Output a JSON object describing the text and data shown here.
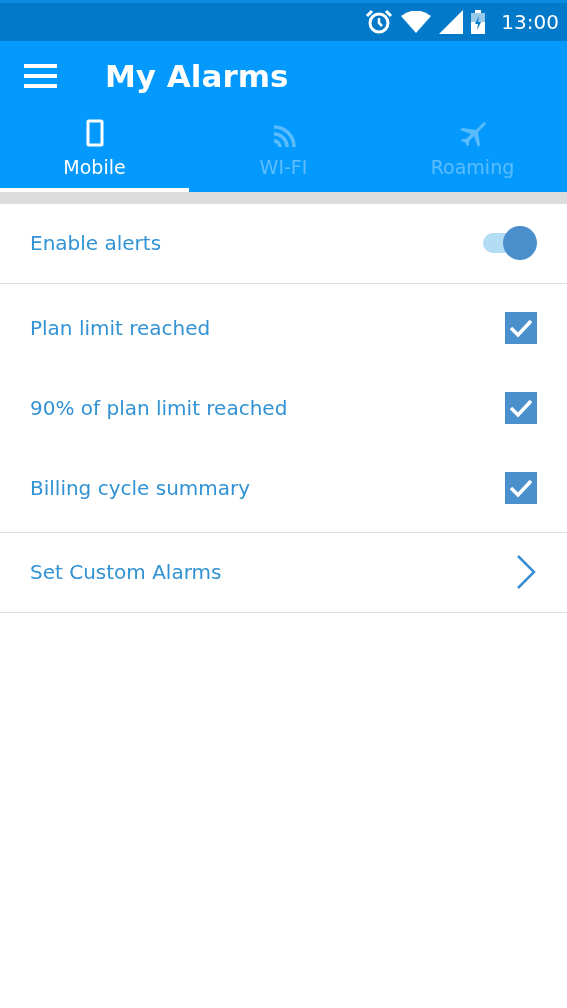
{
  "status_bar": {
    "time": "13:00"
  },
  "app_bar": {
    "title": "My Alarms"
  },
  "tabs": [
    {
      "label": "Mobile",
      "kind": "phone",
      "selected": true
    },
    {
      "label": "WI-FI",
      "kind": "wifi",
      "selected": false
    },
    {
      "label": "Roaming",
      "kind": "plane",
      "selected": false
    }
  ],
  "enable_alerts": {
    "label": "Enable alerts",
    "on": true
  },
  "alerts": [
    {
      "label": "Plan limit reached",
      "checked": true
    },
    {
      "label": "90% of plan limit reached",
      "checked": true
    },
    {
      "label": "Billing cycle summary",
      "checked": true
    }
  ],
  "custom_alarms": {
    "label": "Set Custom Alarms"
  }
}
